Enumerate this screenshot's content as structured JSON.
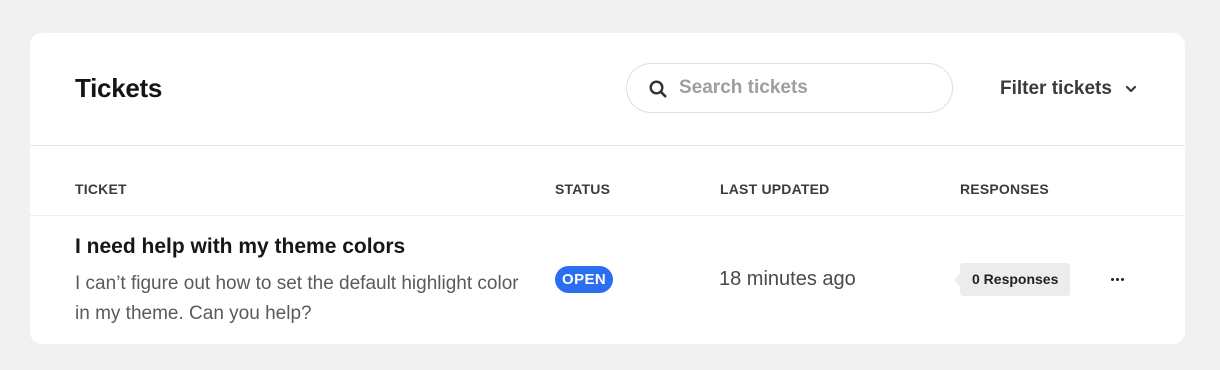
{
  "header": {
    "title": "Tickets",
    "search": {
      "placeholder": "Search tickets",
      "value": ""
    },
    "filter_label": "Filter tickets",
    "icons": {
      "search": "search-icon",
      "filter": "chevron-down-icon"
    }
  },
  "table": {
    "columns": [
      "TICKET",
      "STATUS",
      "LAST UPDATED",
      "RESPONSES"
    ],
    "rows": [
      {
        "title": "I need help with my theme colors",
        "description": "I can’t figure out how to set the default highlight color in my theme. Can you help?",
        "status": "OPEN",
        "last_updated": "18 minutes ago",
        "responses": "0 Responses",
        "actions_icon": "more-horizontal-icon"
      }
    ]
  },
  "colors": {
    "status_open": "#2c6ef2",
    "background": "#f1f1f1",
    "card": "#ffffff"
  }
}
